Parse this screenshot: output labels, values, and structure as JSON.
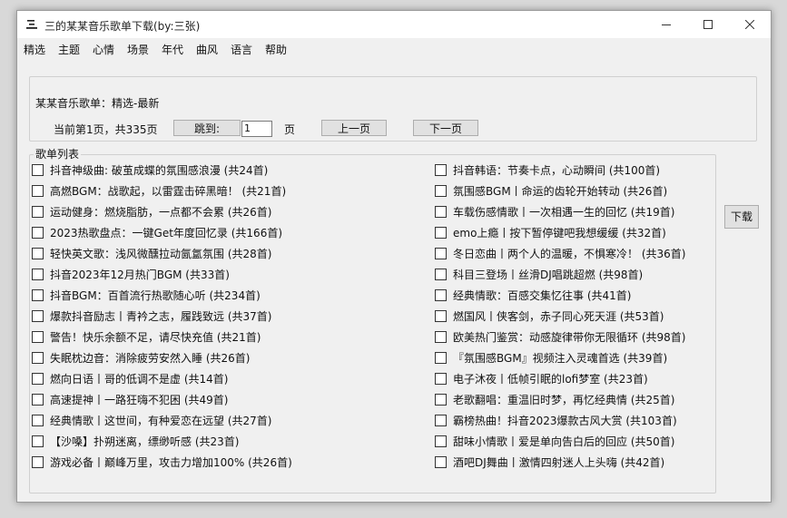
{
  "window": {
    "title": "三的某某音乐歌单下载(by:三张)"
  },
  "menu": [
    "精选",
    "主题",
    "心情",
    "场景",
    "年代",
    "曲风",
    "语言",
    "帮助"
  ],
  "info": {
    "playlist_title": "某某音乐歌单：精选-最新",
    "page_status": "当前第1页，共335页",
    "jump_label": "跳到:",
    "page_input_value": "1",
    "page_unit": "页",
    "prev_label": "上一页",
    "next_label": "下一页"
  },
  "list": {
    "label": "歌单列表",
    "left": [
      "抖音神级曲: 破茧成蝶的氛围感浪漫 (共24首)",
      "高燃BGM：战歌起，以雷霆击碎黑暗！ (共21首)",
      "运动健身：燃烧脂肪，一点都不会累 (共26首)",
      "2023热歌盘点：一键Get年度回忆录 (共166首)",
      "轻快英文歌：浅风微醺拉动氤氲氛围 (共28首)",
      "抖音2023年12月热门BGM (共33首)",
      "抖音BGM：百首流行热歌随心听 (共234首)",
      "爆款抖音励志丨青衿之志，履践致远 (共37首)",
      "警告！快乐余额不足，请尽快充值 (共21首)",
      "失眠枕边音：消除疲劳安然入睡 (共26首)",
      "燃向日语丨哥的低调不是虚 (共14首)",
      "高速提神丨一路狂嗨不犯困 (共49首)",
      "经典情歌丨这世间，有种爱恋在远望 (共27首)",
      "【沙嗓】扑朔迷离，缥缈听感 (共23首)",
      "游戏必备丨巅峰万里，攻击力增加100% (共26首)"
    ],
    "right": [
      "抖音韩语：节奏卡点，心动瞬间 (共100首)",
      "氛围感BGM丨命运的齿轮开始转动 (共26首)",
      "车载伤感情歌丨一次相遇一生的回忆 (共19首)",
      "emo上瘾丨按下暂停键吧我想缓缓 (共32首)",
      "冬日恋曲丨两个人的温暖，不惧寒冷！ (共36首)",
      "科目三登场丨丝滑DJ唱跳超燃 (共98首)",
      "经典情歌：百感交集忆往事 (共41首)",
      "燃国风丨侠客剑，赤子同心死天涯 (共53首)",
      "欧美热门鉴赏：动感旋律带你无限循环 (共98首)",
      "『氛围感BGM』视频注入灵魂首选 (共39首)",
      "电子沐夜丨低帧引眠的lofi梦室 (共23首)",
      "老歌翻唱：重温旧时梦，再忆经典情 (共25首)",
      "霸榜热曲！抖音2023爆款古风大赏 (共103首)",
      "甜味小情歌丨爱是单向告白后的回应 (共50首)",
      "酒吧DJ舞曲丨激情四射迷人上头嗨 (共42首)"
    ]
  },
  "download_label": "下载"
}
